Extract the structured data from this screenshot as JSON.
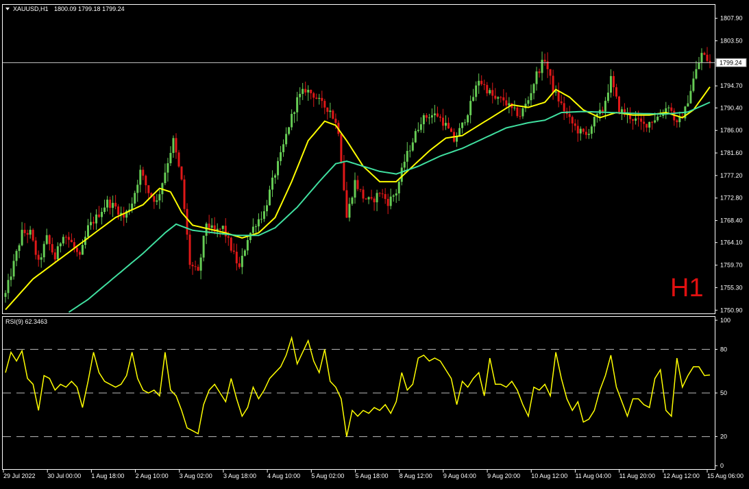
{
  "chart_data": {
    "type": "candlestick",
    "header": {
      "symbol_timeframe": "XAUUSD,H1",
      "ohlc_text": "1800.09 1799.18 1799.24"
    },
    "watermark": "H1",
    "current_price_label": "1799.24",
    "current_price": 1799.24,
    "price_axis": {
      "range": [
        1750.4,
        1810.4
      ],
      "ticks": [
        "1807.90",
        "1803.50",
        "1799.24",
        "1794.70",
        "1790.40",
        "1786.00",
        "1781.60",
        "1777.20",
        "1772.80",
        "1768.40",
        "1764.10",
        "1759.70",
        "1755.30",
        "1750.90"
      ],
      "tick_values": [
        1807.9,
        1803.5,
        1794.7,
        1790.4,
        1786.0,
        1781.6,
        1777.2,
        1772.8,
        1768.4,
        1764.1,
        1759.7,
        1755.3,
        1750.9
      ]
    },
    "time_axis": {
      "labels": [
        "29 Jul 2022",
        "30 Jul 00:00",
        "1 Aug 18:00",
        "2 Aug 10:00",
        "3 Aug 02:00",
        "3 Aug 18:00",
        "4 Aug 10:00",
        "5 Aug 02:00",
        "5 Aug 18:00",
        "8 Aug 12:00",
        "9 Aug 04:00",
        "9 Aug 20:00",
        "10 Aug 12:00",
        "11 Aug 04:00",
        "11 Aug 20:00",
        "12 Aug 12:00",
        "15 Aug 06:00"
      ]
    },
    "price_keypoints": [
      [
        0,
        1754
      ],
      [
        3,
        1760
      ],
      [
        6,
        1766
      ],
      [
        9,
        1766
      ],
      [
        12,
        1760
      ],
      [
        15,
        1765
      ],
      [
        18,
        1761
      ],
      [
        21,
        1766
      ],
      [
        24,
        1764
      ],
      [
        27,
        1761
      ],
      [
        30,
        1767
      ],
      [
        33,
        1769
      ],
      [
        37,
        1772
      ],
      [
        40,
        1771
      ],
      [
        43,
        1769
      ],
      [
        46,
        1772
      ],
      [
        49,
        1778
      ],
      [
        52,
        1774
      ],
      [
        55,
        1772
      ],
      [
        58,
        1778
      ],
      [
        61,
        1784
      ],
      [
        64,
        1776
      ],
      [
        67,
        1760
      ],
      [
        70,
        1758
      ],
      [
        73,
        1768
      ],
      [
        76,
        1766
      ],
      [
        79,
        1767
      ],
      [
        82,
        1763
      ],
      [
        85,
        1759
      ],
      [
        88,
        1765
      ],
      [
        91,
        1768
      ],
      [
        94,
        1770
      ],
      [
        97,
        1776
      ],
      [
        100,
        1781
      ],
      [
        103,
        1787
      ],
      [
        106,
        1792
      ],
      [
        109,
        1794
      ],
      [
        112,
        1793
      ],
      [
        115,
        1791
      ],
      [
        118,
        1790
      ],
      [
        121,
        1786
      ],
      [
        124,
        1769
      ],
      [
        127,
        1776
      ],
      [
        130,
        1773
      ],
      [
        133,
        1772
      ],
      [
        136,
        1774
      ],
      [
        139,
        1772
      ],
      [
        142,
        1774
      ],
      [
        145,
        1780
      ],
      [
        148,
        1784
      ],
      [
        151,
        1788
      ],
      [
        154,
        1789
      ],
      [
        157,
        1789
      ],
      [
        160,
        1787
      ],
      [
        163,
        1784
      ],
      [
        166,
        1787
      ],
      [
        169,
        1791
      ],
      [
        172,
        1796
      ],
      [
        175,
        1794
      ],
      [
        178,
        1792
      ],
      [
        181,
        1792
      ],
      [
        184,
        1790
      ],
      [
        187,
        1789
      ],
      [
        190,
        1792
      ],
      [
        193,
        1797
      ],
      [
        196,
        1800
      ],
      [
        199,
        1794
      ],
      [
        202,
        1791
      ],
      [
        205,
        1788
      ],
      [
        208,
        1786
      ],
      [
        211,
        1785
      ],
      [
        214,
        1788
      ],
      [
        217,
        1790
      ],
      [
        220,
        1796
      ],
      [
        223,
        1790
      ],
      [
        226,
        1789
      ],
      [
        229,
        1788
      ],
      [
        232,
        1787
      ],
      [
        235,
        1788
      ],
      [
        238,
        1789
      ],
      [
        241,
        1791
      ],
      [
        244,
        1787
      ],
      [
        247,
        1790
      ],
      [
        250,
        1796
      ],
      [
        253,
        1801
      ],
      [
        256,
        1799.24
      ]
    ],
    "indicators": [
      {
        "name": "MA",
        "color": "#ffff00",
        "keypoints": [
          [
            0,
            1751
          ],
          [
            10,
            1757
          ],
          [
            20,
            1761
          ],
          [
            30,
            1765
          ],
          [
            40,
            1769
          ],
          [
            50,
            1771.5
          ],
          [
            56,
            1774.7
          ],
          [
            60,
            1774
          ],
          [
            64,
            1770
          ],
          [
            68,
            1767.5
          ],
          [
            72,
            1767
          ],
          [
            80,
            1766
          ],
          [
            86,
            1765
          ],
          [
            92,
            1766
          ],
          [
            98,
            1769
          ],
          [
            104,
            1776
          ],
          [
            110,
            1784
          ],
          [
            116,
            1787.8
          ],
          [
            120,
            1787
          ],
          [
            124,
            1784
          ],
          [
            130,
            1779
          ],
          [
            136,
            1776
          ],
          [
            142,
            1776
          ],
          [
            148,
            1779
          ],
          [
            154,
            1782
          ],
          [
            160,
            1784.5
          ],
          [
            166,
            1785
          ],
          [
            172,
            1787
          ],
          [
            178,
            1789
          ],
          [
            184,
            1791
          ],
          [
            190,
            1790.5
          ],
          [
            196,
            1791.5
          ],
          [
            200,
            1794
          ],
          [
            205,
            1792.5
          ],
          [
            210,
            1790
          ],
          [
            216,
            1788.5
          ],
          [
            222,
            1789.5
          ],
          [
            228,
            1789
          ],
          [
            234,
            1789
          ],
          [
            240,
            1789.5
          ],
          [
            246,
            1788.5
          ],
          [
            250,
            1790
          ],
          [
            256,
            1794.5
          ]
        ]
      },
      {
        "name": "MA",
        "color": "#40e0a0",
        "keypoints": [
          [
            23,
            1750.5
          ],
          [
            30,
            1753
          ],
          [
            40,
            1757.5
          ],
          [
            50,
            1762
          ],
          [
            58,
            1766
          ],
          [
            62,
            1767.7
          ],
          [
            68,
            1766.5
          ],
          [
            76,
            1766
          ],
          [
            84,
            1765.5
          ],
          [
            92,
            1765.5
          ],
          [
            98,
            1767
          ],
          [
            106,
            1771
          ],
          [
            114,
            1776
          ],
          [
            120,
            1779.5
          ],
          [
            124,
            1780
          ],
          [
            130,
            1779
          ],
          [
            136,
            1778
          ],
          [
            142,
            1777.5
          ],
          [
            150,
            1779
          ],
          [
            158,
            1781
          ],
          [
            166,
            1782.5
          ],
          [
            174,
            1784.5
          ],
          [
            182,
            1786.5
          ],
          [
            190,
            1787.5
          ],
          [
            196,
            1788
          ],
          [
            202,
            1789.5
          ],
          [
            210,
            1789.7
          ],
          [
            220,
            1789.5
          ],
          [
            230,
            1789.3
          ],
          [
            240,
            1789.2
          ],
          [
            248,
            1789.6
          ],
          [
            256,
            1791.5
          ]
        ]
      }
    ],
    "rsi": {
      "label": "RSI(9) 62.3463",
      "ylim": [
        0,
        100
      ],
      "ticks": [
        "100",
        "80",
        "50",
        "20",
        "0"
      ],
      "levels": [
        80,
        50,
        20
      ],
      "color": "#ffff00",
      "keypoints": [
        [
          0,
          64
        ],
        [
          2,
          78
        ],
        [
          4,
          72
        ],
        [
          6,
          79
        ],
        [
          8,
          60
        ],
        [
          10,
          56
        ],
        [
          12,
          38
        ],
        [
          14,
          62
        ],
        [
          16,
          60
        ],
        [
          18,
          52
        ],
        [
          20,
          56
        ],
        [
          22,
          54
        ],
        [
          24,
          58
        ],
        [
          26,
          54
        ],
        [
          28,
          40
        ],
        [
          30,
          58
        ],
        [
          32,
          78
        ],
        [
          34,
          64
        ],
        [
          36,
          58
        ],
        [
          38,
          56
        ],
        [
          40,
          54
        ],
        [
          42,
          56
        ],
        [
          44,
          62
        ],
        [
          46,
          78
        ],
        [
          48,
          60
        ],
        [
          50,
          52
        ],
        [
          52,
          50
        ],
        [
          54,
          52
        ],
        [
          56,
          48
        ],
        [
          58,
          78
        ],
        [
          60,
          52
        ],
        [
          62,
          48
        ],
        [
          64,
          38
        ],
        [
          66,
          26
        ],
        [
          68,
          24
        ],
        [
          70,
          22
        ],
        [
          72,
          42
        ],
        [
          74,
          52
        ],
        [
          76,
          56
        ],
        [
          78,
          50
        ],
        [
          80,
          44
        ],
        [
          82,
          60
        ],
        [
          84,
          46
        ],
        [
          86,
          34
        ],
        [
          88,
          40
        ],
        [
          90,
          54
        ],
        [
          92,
          46
        ],
        [
          94,
          52
        ],
        [
          96,
          60
        ],
        [
          98,
          64
        ],
        [
          100,
          68
        ],
        [
          102,
          76
        ],
        [
          104,
          88
        ],
        [
          106,
          70
        ],
        [
          108,
          78
        ],
        [
          110,
          86
        ],
        [
          112,
          72
        ],
        [
          114,
          64
        ],
        [
          116,
          80
        ],
        [
          118,
          58
        ],
        [
          120,
          54
        ],
        [
          122,
          46
        ],
        [
          124,
          20
        ],
        [
          126,
          38
        ],
        [
          128,
          34
        ],
        [
          130,
          38
        ],
        [
          132,
          36
        ],
        [
          134,
          40
        ],
        [
          136,
          38
        ],
        [
          138,
          42
        ],
        [
          140,
          36
        ],
        [
          142,
          44
        ],
        [
          144,
          64
        ],
        [
          146,
          52
        ],
        [
          148,
          56
        ],
        [
          150,
          74
        ],
        [
          152,
          76
        ],
        [
          154,
          72
        ],
        [
          156,
          74
        ],
        [
          158,
          72
        ],
        [
          160,
          66
        ],
        [
          162,
          60
        ],
        [
          164,
          42
        ],
        [
          166,
          58
        ],
        [
          168,
          54
        ],
        [
          170,
          60
        ],
        [
          172,
          64
        ],
        [
          174,
          48
        ],
        [
          176,
          74
        ],
        [
          178,
          56
        ],
        [
          180,
          56
        ],
        [
          182,
          54
        ],
        [
          184,
          58
        ],
        [
          186,
          52
        ],
        [
          188,
          42
        ],
        [
          190,
          34
        ],
        [
          192,
          54
        ],
        [
          194,
          52
        ],
        [
          196,
          56
        ],
        [
          198,
          48
        ],
        [
          200,
          78
        ],
        [
          202,
          60
        ],
        [
          204,
          46
        ],
        [
          206,
          38
        ],
        [
          208,
          44
        ],
        [
          210,
          30
        ],
        [
          212,
          32
        ],
        [
          214,
          38
        ],
        [
          216,
          52
        ],
        [
          218,
          62
        ],
        [
          220,
          76
        ],
        [
          222,
          54
        ],
        [
          224,
          44
        ],
        [
          226,
          34
        ],
        [
          228,
          46
        ],
        [
          230,
          46
        ],
        [
          232,
          42
        ],
        [
          234,
          40
        ],
        [
          236,
          60
        ],
        [
          238,
          66
        ],
        [
          240,
          38
        ],
        [
          242,
          34
        ],
        [
          244,
          74
        ],
        [
          246,
          54
        ],
        [
          248,
          62
        ],
        [
          250,
          68
        ],
        [
          252,
          68
        ],
        [
          254,
          62
        ],
        [
          256,
          62.35
        ]
      ]
    }
  }
}
